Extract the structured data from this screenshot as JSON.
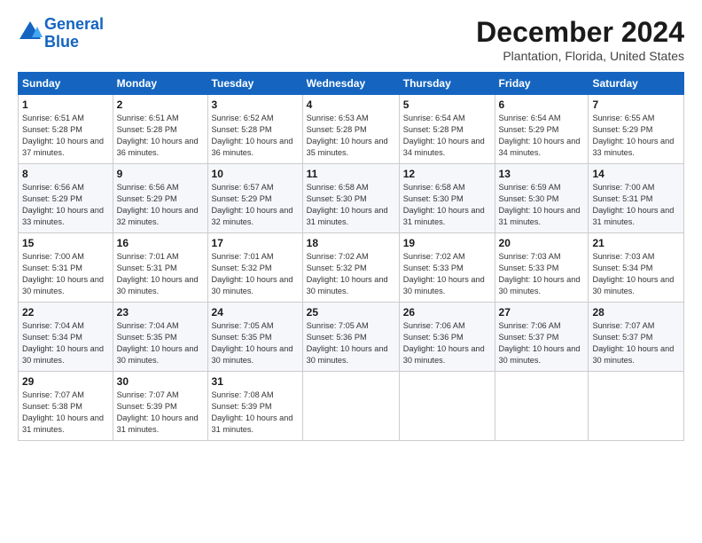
{
  "logo": {
    "line1": "General",
    "line2": "Blue"
  },
  "title": "December 2024",
  "location": "Plantation, Florida, United States",
  "days_of_week": [
    "Sunday",
    "Monday",
    "Tuesday",
    "Wednesday",
    "Thursday",
    "Friday",
    "Saturday"
  ],
  "weeks": [
    [
      {
        "day": 1,
        "sunrise": "6:51 AM",
        "sunset": "5:28 PM",
        "daylight": "10 hours and 37 minutes."
      },
      {
        "day": 2,
        "sunrise": "6:51 AM",
        "sunset": "5:28 PM",
        "daylight": "10 hours and 36 minutes."
      },
      {
        "day": 3,
        "sunrise": "6:52 AM",
        "sunset": "5:28 PM",
        "daylight": "10 hours and 36 minutes."
      },
      {
        "day": 4,
        "sunrise": "6:53 AM",
        "sunset": "5:28 PM",
        "daylight": "10 hours and 35 minutes."
      },
      {
        "day": 5,
        "sunrise": "6:54 AM",
        "sunset": "5:28 PM",
        "daylight": "10 hours and 34 minutes."
      },
      {
        "day": 6,
        "sunrise": "6:54 AM",
        "sunset": "5:29 PM",
        "daylight": "10 hours and 34 minutes."
      },
      {
        "day": 7,
        "sunrise": "6:55 AM",
        "sunset": "5:29 PM",
        "daylight": "10 hours and 33 minutes."
      }
    ],
    [
      {
        "day": 8,
        "sunrise": "6:56 AM",
        "sunset": "5:29 PM",
        "daylight": "10 hours and 33 minutes."
      },
      {
        "day": 9,
        "sunrise": "6:56 AM",
        "sunset": "5:29 PM",
        "daylight": "10 hours and 32 minutes."
      },
      {
        "day": 10,
        "sunrise": "6:57 AM",
        "sunset": "5:29 PM",
        "daylight": "10 hours and 32 minutes."
      },
      {
        "day": 11,
        "sunrise": "6:58 AM",
        "sunset": "5:30 PM",
        "daylight": "10 hours and 31 minutes."
      },
      {
        "day": 12,
        "sunrise": "6:58 AM",
        "sunset": "5:30 PM",
        "daylight": "10 hours and 31 minutes."
      },
      {
        "day": 13,
        "sunrise": "6:59 AM",
        "sunset": "5:30 PM",
        "daylight": "10 hours and 31 minutes."
      },
      {
        "day": 14,
        "sunrise": "7:00 AM",
        "sunset": "5:31 PM",
        "daylight": "10 hours and 31 minutes."
      }
    ],
    [
      {
        "day": 15,
        "sunrise": "7:00 AM",
        "sunset": "5:31 PM",
        "daylight": "10 hours and 30 minutes."
      },
      {
        "day": 16,
        "sunrise": "7:01 AM",
        "sunset": "5:31 PM",
        "daylight": "10 hours and 30 minutes."
      },
      {
        "day": 17,
        "sunrise": "7:01 AM",
        "sunset": "5:32 PM",
        "daylight": "10 hours and 30 minutes."
      },
      {
        "day": 18,
        "sunrise": "7:02 AM",
        "sunset": "5:32 PM",
        "daylight": "10 hours and 30 minutes."
      },
      {
        "day": 19,
        "sunrise": "7:02 AM",
        "sunset": "5:33 PM",
        "daylight": "10 hours and 30 minutes."
      },
      {
        "day": 20,
        "sunrise": "7:03 AM",
        "sunset": "5:33 PM",
        "daylight": "10 hours and 30 minutes."
      },
      {
        "day": 21,
        "sunrise": "7:03 AM",
        "sunset": "5:34 PM",
        "daylight": "10 hours and 30 minutes."
      }
    ],
    [
      {
        "day": 22,
        "sunrise": "7:04 AM",
        "sunset": "5:34 PM",
        "daylight": "10 hours and 30 minutes."
      },
      {
        "day": 23,
        "sunrise": "7:04 AM",
        "sunset": "5:35 PM",
        "daylight": "10 hours and 30 minutes."
      },
      {
        "day": 24,
        "sunrise": "7:05 AM",
        "sunset": "5:35 PM",
        "daylight": "10 hours and 30 minutes."
      },
      {
        "day": 25,
        "sunrise": "7:05 AM",
        "sunset": "5:36 PM",
        "daylight": "10 hours and 30 minutes."
      },
      {
        "day": 26,
        "sunrise": "7:06 AM",
        "sunset": "5:36 PM",
        "daylight": "10 hours and 30 minutes."
      },
      {
        "day": 27,
        "sunrise": "7:06 AM",
        "sunset": "5:37 PM",
        "daylight": "10 hours and 30 minutes."
      },
      {
        "day": 28,
        "sunrise": "7:07 AM",
        "sunset": "5:37 PM",
        "daylight": "10 hours and 30 minutes."
      }
    ],
    [
      {
        "day": 29,
        "sunrise": "7:07 AM",
        "sunset": "5:38 PM",
        "daylight": "10 hours and 31 minutes."
      },
      {
        "day": 30,
        "sunrise": "7:07 AM",
        "sunset": "5:39 PM",
        "daylight": "10 hours and 31 minutes."
      },
      {
        "day": 31,
        "sunrise": "7:08 AM",
        "sunset": "5:39 PM",
        "daylight": "10 hours and 31 minutes."
      },
      null,
      null,
      null,
      null
    ]
  ]
}
